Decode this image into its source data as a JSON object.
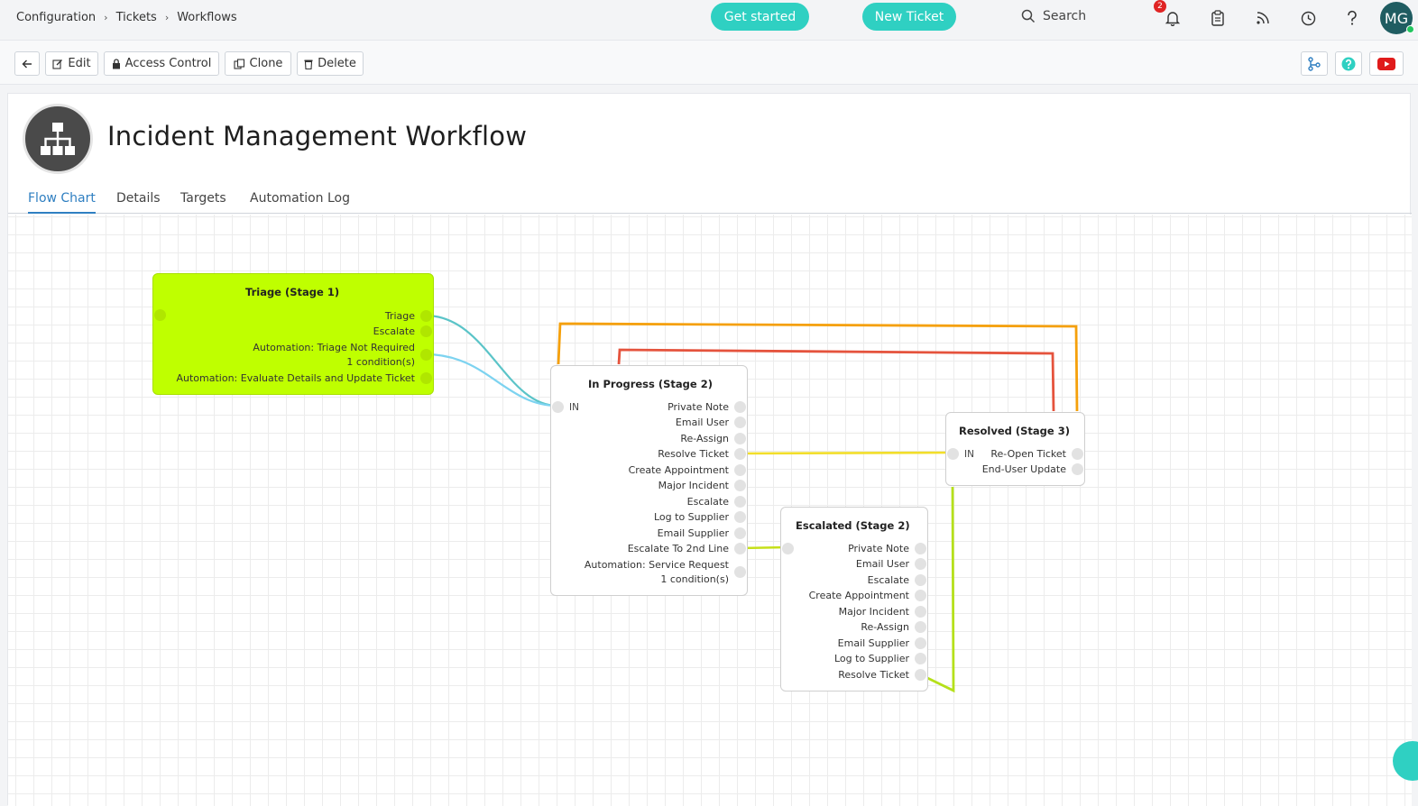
{
  "breadcrumb": [
    "Configuration",
    "Tickets",
    "Workflows"
  ],
  "header": {
    "get_started": "Get started",
    "new_ticket": "New Ticket",
    "search": "Search",
    "notification_count": "2",
    "avatar_initials": "MG"
  },
  "toolbar": {
    "edit": "Edit",
    "access_control": "Access Control",
    "clone": "Clone",
    "delete": "Delete"
  },
  "page": {
    "title": "Incident Management Workflow",
    "tabs": [
      "Flow Chart",
      "Details",
      "Targets",
      "Automation Log"
    ],
    "active_tab": "Flow Chart"
  },
  "flow": {
    "in_label": "IN",
    "nodes": [
      {
        "id": "triage",
        "title": "Triage (Stage 1)",
        "color": "#bfff00",
        "outputs": [
          "Triage",
          "Escalate",
          "Automation: Triage Not Required",
          "1 condition(s)",
          "Automation: Evaluate Details and Update Ticket"
        ]
      },
      {
        "id": "in_progress",
        "title": "In Progress (Stage 2)",
        "outputs": [
          "Private Note",
          "Email User",
          "Re-Assign",
          "Resolve Ticket",
          "Create Appointment",
          "Major Incident",
          "Escalate",
          "Log to Supplier",
          "Email Supplier",
          "Escalate To 2nd Line",
          "Automation: Service Request",
          "1 condition(s)"
        ]
      },
      {
        "id": "resolved",
        "title": "Resolved (Stage 3)",
        "outputs": [
          "Re-Open Ticket",
          "End-User Update"
        ]
      },
      {
        "id": "escalated",
        "title": "Escalated (Stage 2)",
        "outputs": [
          "Private Note",
          "Email User",
          "Escalate",
          "Create Appointment",
          "Major Incident",
          "Re-Assign",
          "Email Supplier",
          "Log to Supplier",
          "Resolve Ticket"
        ]
      }
    ],
    "link_colors": {
      "triage": "#5bc4c8",
      "escalate": "#7dd3f0",
      "resolve": "#f2de2a",
      "escalate_2nd": "#c6e01a",
      "reopen": "#f59e0b",
      "end_user_update": "#e5533d",
      "escalated_resolve": "#b5e01a"
    }
  }
}
